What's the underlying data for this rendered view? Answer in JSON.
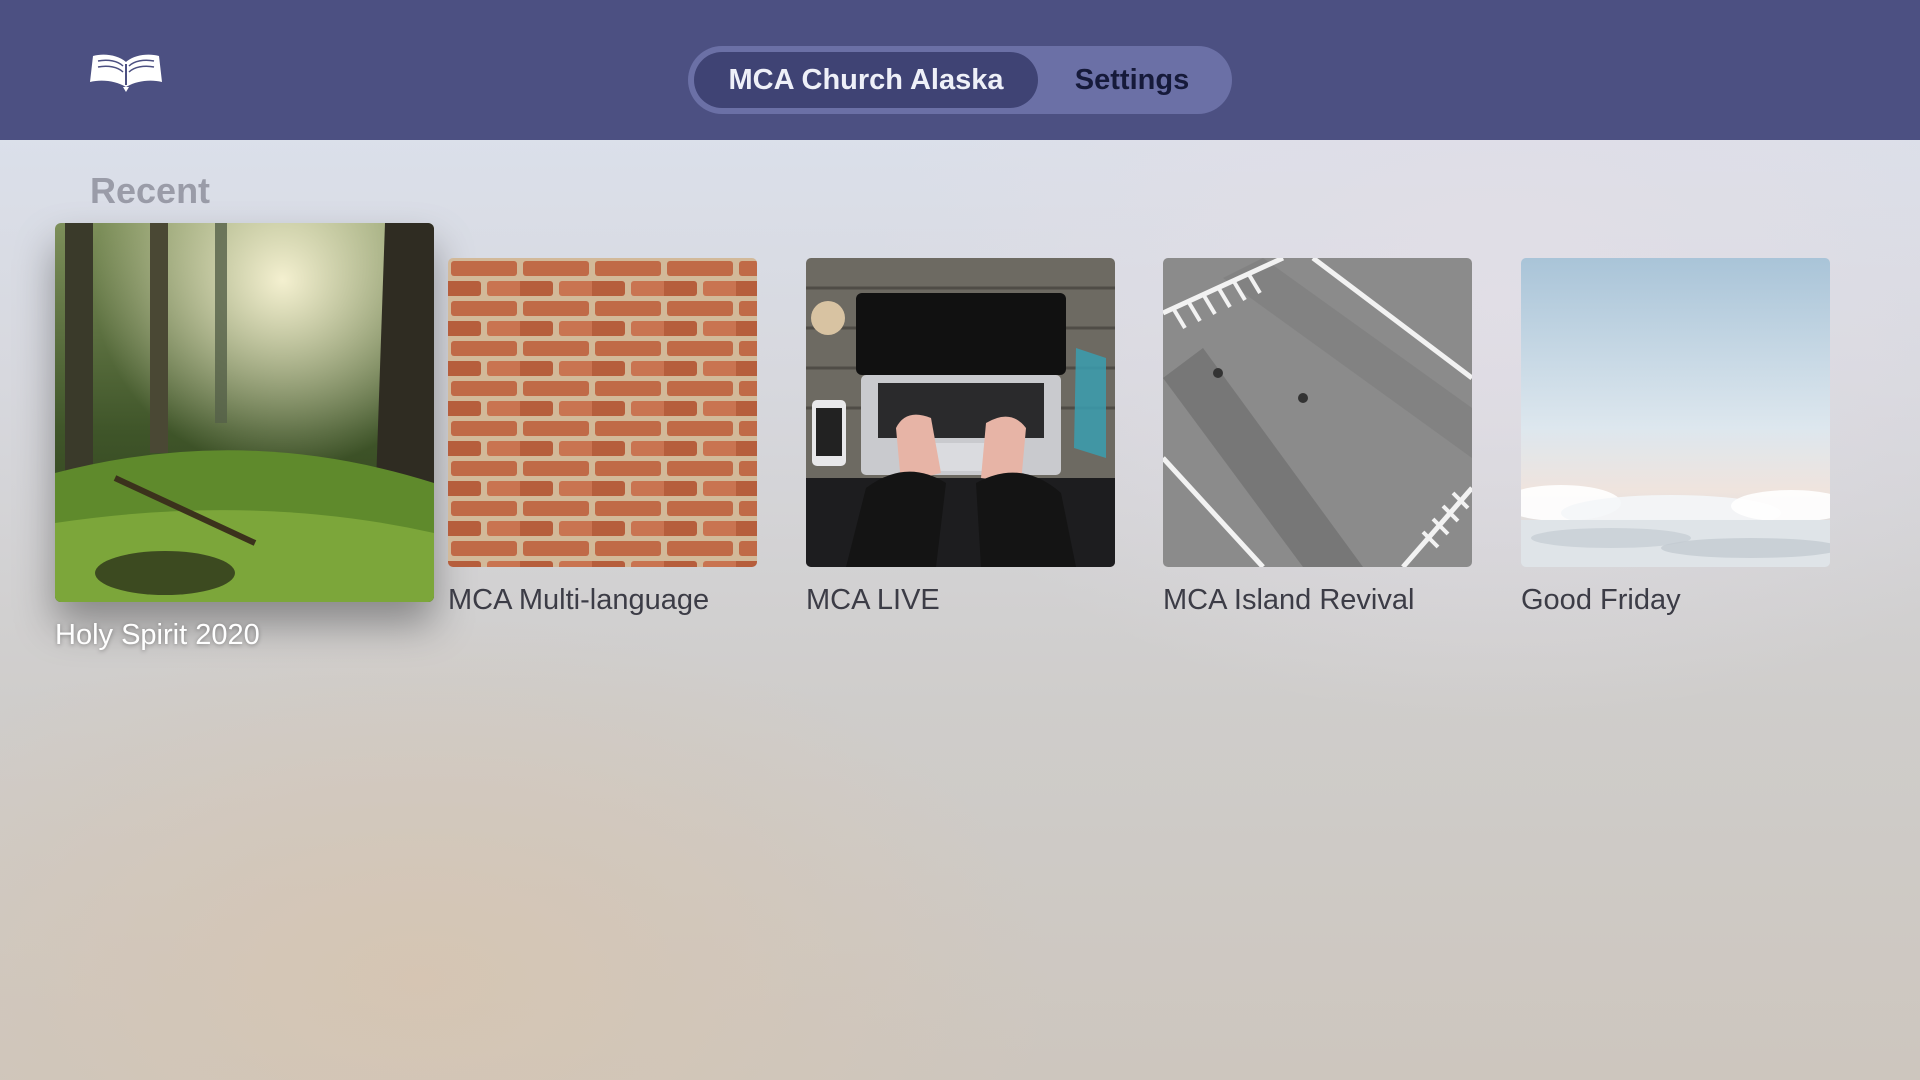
{
  "header": {
    "logo_icon": "open-book-icon",
    "tabs": [
      {
        "label": "MCA Church Alaska",
        "selected": true
      },
      {
        "label": "Settings",
        "selected": false
      }
    ]
  },
  "section": {
    "title": "Recent"
  },
  "cards": [
    {
      "title": "Holy Spirit 2020",
      "image": "forest-photo",
      "focused": true
    },
    {
      "title": "MCA Multi-language",
      "image": "brick-wall-photo",
      "focused": false
    },
    {
      "title": "MCA LIVE",
      "image": "laptop-typing-photo",
      "focused": false
    },
    {
      "title": "MCA Island Revival",
      "image": "parking-lot-aerial-photo",
      "focused": false
    },
    {
      "title": "Good Friday",
      "image": "clouds-sky-photo",
      "focused": false
    }
  ],
  "colors": {
    "header_bg": "#4c5082",
    "tab_selected_bg": "#3f4374",
    "tab_track_bg": "#6b70a6"
  }
}
